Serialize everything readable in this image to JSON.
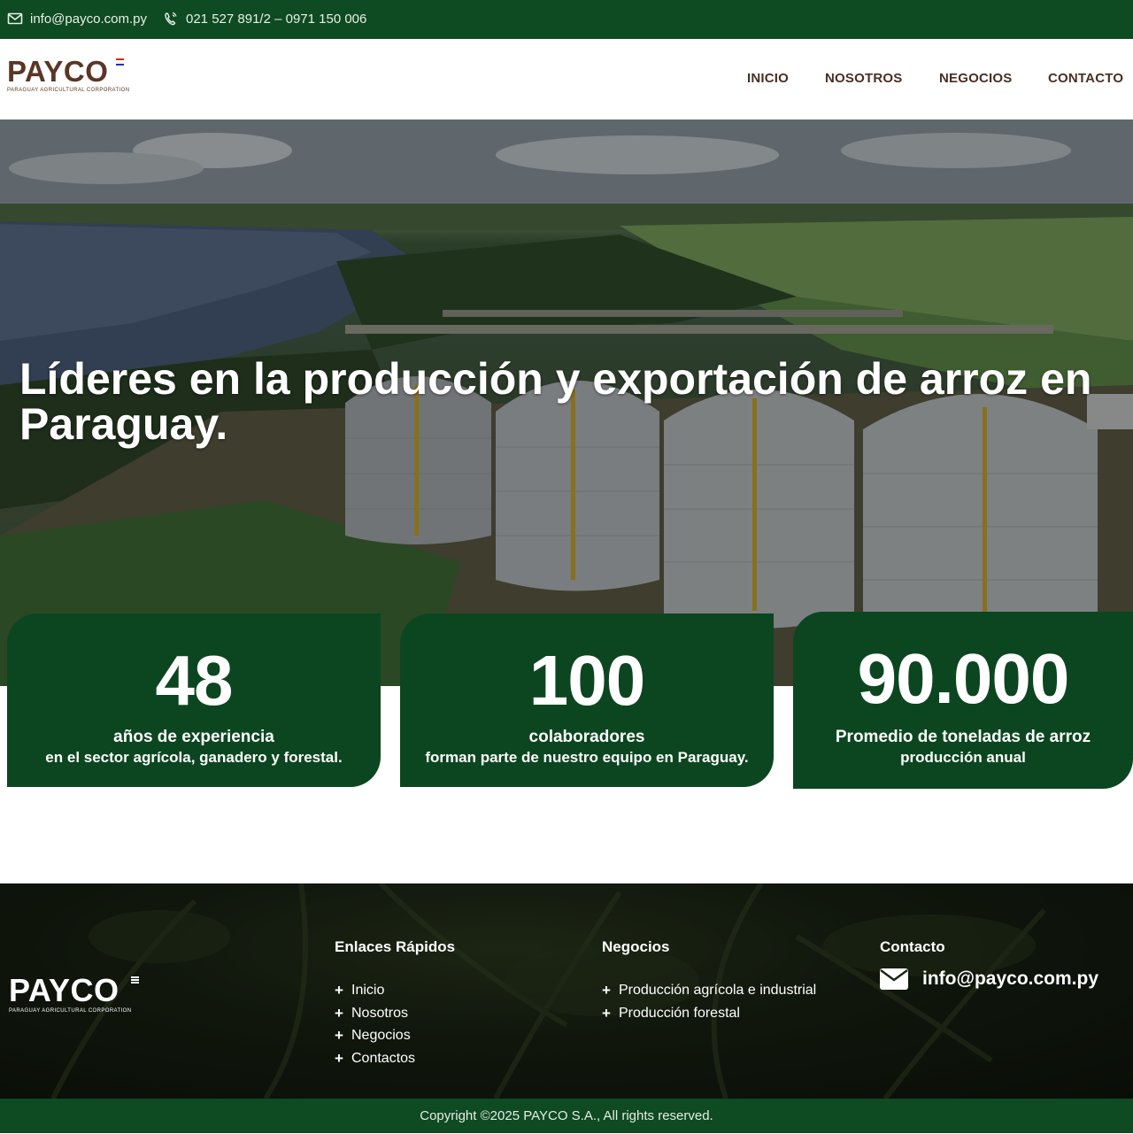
{
  "topbar": {
    "email": "info@payco.com.py",
    "phone": "021 527 891/2 – 0971 150 006",
    "email_icon": "envelope-icon",
    "phone_icon": "phone-icon"
  },
  "header": {
    "logo_word": "PAYCO",
    "logo_sub": "PARAGUAY AGRICULTURAL CORPORATION",
    "nav": [
      "INICIO",
      "NOSOTROS",
      "NEGOCIOS",
      "CONTACTO"
    ]
  },
  "hero": {
    "title": "Líderes en la producción y exportación de arroz en Paraguay."
  },
  "stats": [
    {
      "number": "48",
      "label": "años de experiencia",
      "desc": "en el sector agrícola, ganadero y forestal."
    },
    {
      "number": "100",
      "label": "colaboradores",
      "desc": "forman parte de nuestro equipo en Paraguay."
    },
    {
      "number": "90.000",
      "label": "Promedio de toneladas de arroz",
      "desc": "producción anual"
    }
  ],
  "footer": {
    "logo_word": "PAYCO",
    "logo_sub": "PARAGUAY AGRICULTURAL CORPORATION",
    "quick_links": {
      "title": "Enlaces Rápidos",
      "items": [
        "Inicio",
        "Nosotros",
        "Negocios",
        "Contactos"
      ]
    },
    "business": {
      "title": "Negocios",
      "items": [
        "Producción agrícola e industrial",
        "Producción forestal"
      ]
    },
    "contact": {
      "title": "Contacto",
      "email": "info@payco.com.py",
      "email_icon": "envelope-icon"
    },
    "copyright": "Copyright ©2025 PAYCO S.A., All rights reserved."
  },
  "colors": {
    "brand_green": "#0e4a22",
    "card_green": "#0c4620",
    "brand_brown": "#5a3626",
    "flag_red": "#d52b1e",
    "flag_blue": "#0038a8"
  }
}
